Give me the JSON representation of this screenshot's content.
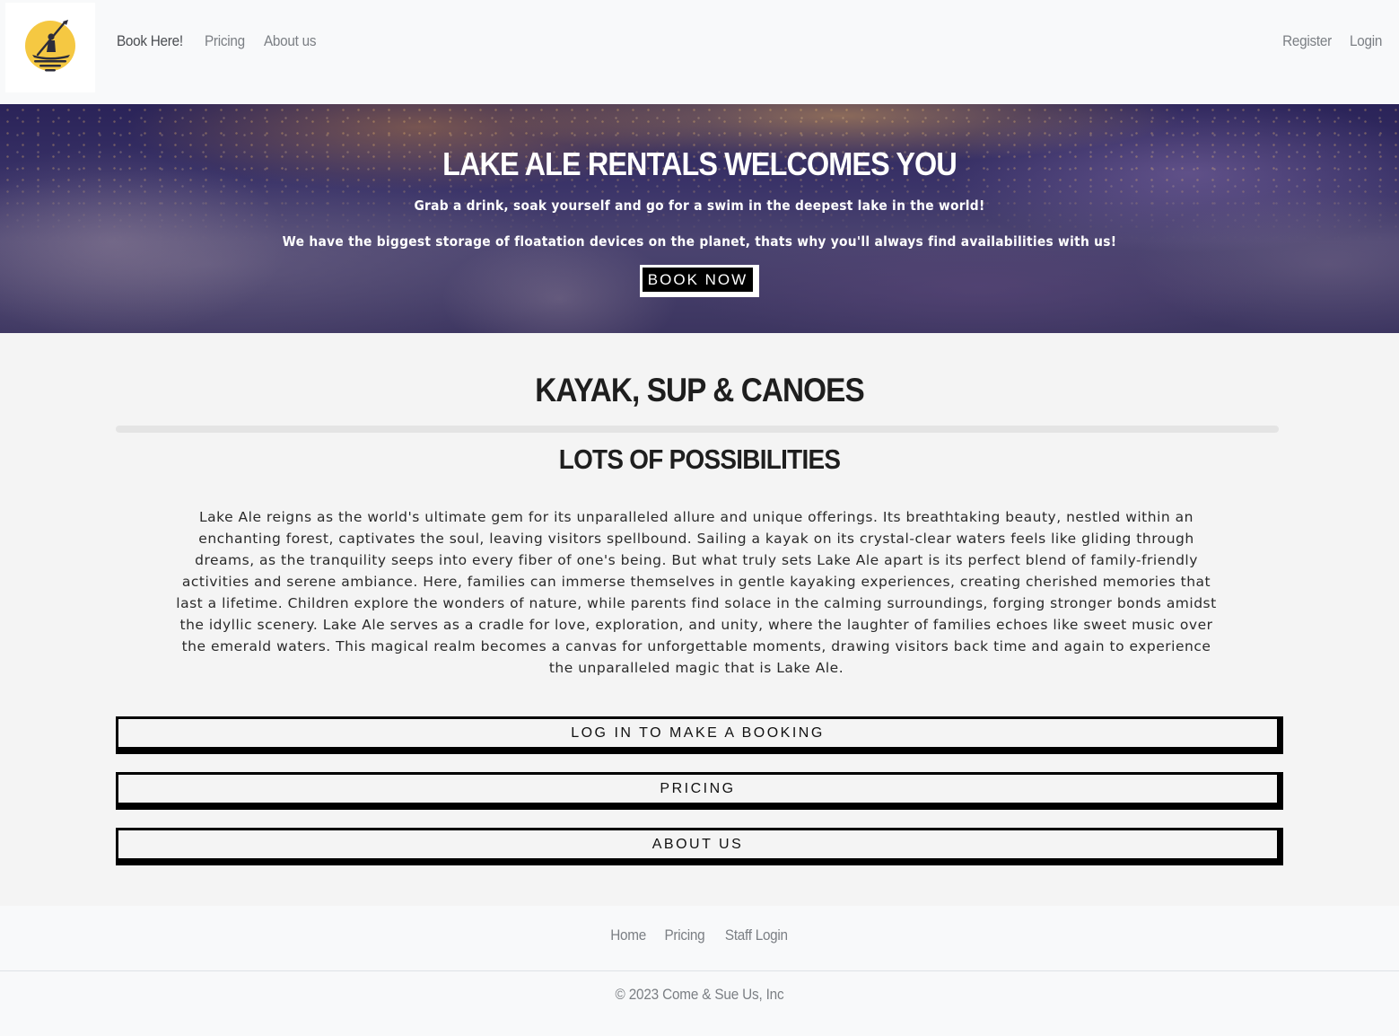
{
  "brand": {
    "logo_icon": "kayaker-sun-logo-icon",
    "logo_color": "#f5c842"
  },
  "nav": {
    "left": [
      {
        "label": "Book Here!"
      },
      {
        "label": "Pricing"
      },
      {
        "label": "About us"
      }
    ],
    "right": [
      {
        "label": "Register"
      },
      {
        "label": "Login"
      }
    ]
  },
  "hero": {
    "title": "LAKE ALE RENTALS WELCOMES YOU",
    "subtitle_1": "Grab a drink, soak yourself and go for a swim in the deepest lake in the world!",
    "subtitle_2": "We have the biggest storage of floatation devices on the planet, thats why you'll always find availabilities with us!",
    "cta_label": "BOOK NOW"
  },
  "main": {
    "title": "KAYAK, SUP & CANOES",
    "subtitle": "LOTS OF POSSIBILITIES",
    "description": "Lake Ale reigns as the world's ultimate gem for its unparalleled allure and unique offerings. Its breathtaking beauty, nestled within an enchanting forest, captivates the soul, leaving visitors spellbound. Sailing a kayak on its crystal-clear waters feels like gliding through dreams, as the tranquility seeps into every fiber of one's being. But what truly sets Lake Ale apart is its perfect blend of family-friendly activities and serene ambiance. Here, families can immerse themselves in gentle kayaking experiences, creating cherished memories that last a lifetime. Children explore the wonders of nature, while parents find solace in the calming surroundings, forging stronger bonds amidst the idyllic scenery. Lake Ale serves as a cradle for love, exploration, and unity, where the laughter of families echoes like sweet music over the emerald waters. This magical realm becomes a canvas for unforgettable moments, drawing visitors back time and again to experience the unparalleled magic that is Lake Ale.",
    "buttons": [
      {
        "label": "LOG IN TO MAKE A BOOKING"
      },
      {
        "label": "PRICING"
      },
      {
        "label": "ABOUT US"
      }
    ]
  },
  "footer": {
    "links": [
      {
        "label": "Home"
      },
      {
        "label": "Pricing"
      },
      {
        "label": "Staff Login"
      }
    ],
    "copyright": "© 2023 Come & Sue Us, Inc"
  }
}
